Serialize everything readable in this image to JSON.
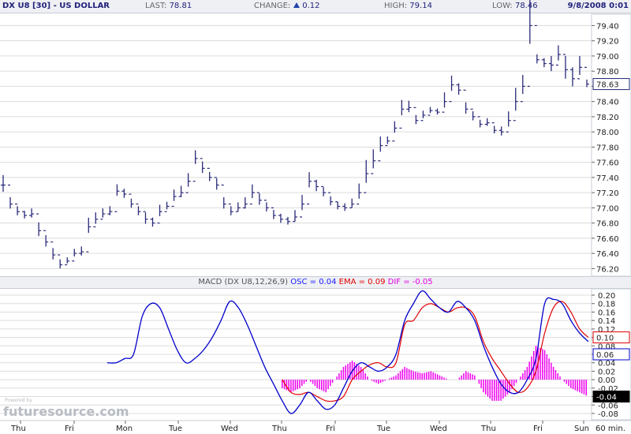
{
  "header": {
    "title": "DX U8 [30] - US DOLLAR",
    "last_label": "LAST:",
    "last_value": "78.81",
    "change_label": "CHANGE:",
    "change_value": "0.12",
    "high_label": "HIGH:",
    "high_value": "79.14",
    "low_label": "LOW:",
    "low_value": "78.46",
    "datetime": "9/8/2008 0:01"
  },
  "macd_legend": {
    "prefix": "MACD (DX U8,12,26,9)",
    "osc": "OSC = 0.04",
    "ema": "EMA = 0.09",
    "dif": "DIF = -0.05"
  },
  "watermark": {
    "small": "Powered by",
    "text": "futuresource.com"
  },
  "colors": {
    "price": "#2a2a7a",
    "macd": "#0000cc",
    "signal": "#e00000",
    "histogram": "#ee00ee",
    "grid": "#dcdcdc",
    "last_tag_border": "#2a2a7a"
  },
  "chart_data": [
    {
      "type": "bar",
      "subtype": "ohlc",
      "title": "DX U8 [30] - US DOLLAR",
      "ylim": [
        76.1,
        79.55
      ],
      "y_ticks": [
        "79.40",
        "79.20",
        "79.00",
        "78.80",
        "78.60",
        "78.40",
        "78.20",
        "78.00",
        "77.80",
        "77.60",
        "77.40",
        "77.20",
        "77.00",
        "76.80",
        "76.60",
        "76.40",
        "76.20"
      ],
      "last_tag": "78.63",
      "x_labels": [
        "Thu",
        "Fri",
        "Mon",
        "Tue",
        "Wed",
        "Thu",
        "Fri",
        "Tue",
        "Wed",
        "Thu",
        "Fri",
        "Sun"
      ],
      "x_suffix": "60 min.",
      "closes": [
        77.3,
        77.05,
        76.95,
        76.9,
        76.92,
        76.7,
        76.55,
        76.38,
        76.25,
        76.3,
        76.4,
        76.42,
        76.75,
        76.85,
        76.92,
        76.95,
        77.22,
        77.18,
        77.05,
        76.95,
        76.85,
        76.8,
        76.95,
        77.02,
        77.15,
        77.2,
        77.35,
        77.65,
        77.52,
        77.4,
        77.3,
        77.05,
        76.95,
        77.0,
        77.05,
        77.2,
        77.1,
        77.0,
        76.9,
        76.85,
        76.82,
        76.88,
        77.05,
        77.35,
        77.28,
        77.2,
        77.08,
        77.02,
        77.0,
        77.05,
        77.2,
        77.45,
        77.62,
        77.82,
        77.88,
        78.05,
        78.3,
        78.32,
        78.15,
        78.22,
        78.28,
        78.26,
        78.4,
        78.62,
        78.55,
        78.3,
        78.2,
        78.1,
        78.12,
        78.02,
        78.0,
        78.15,
        78.4,
        78.6,
        79.4,
        78.95,
        78.9,
        78.88,
        79.02,
        78.82,
        78.7,
        78.85,
        78.63
      ],
      "ranges": [
        0.22,
        0.15,
        0.12,
        0.1,
        0.12,
        0.18,
        0.15,
        0.15,
        0.12,
        0.08,
        0.1,
        0.12,
        0.2,
        0.15,
        0.12,
        0.12,
        0.15,
        0.12,
        0.12,
        0.12,
        0.15,
        0.12,
        0.15,
        0.1,
        0.15,
        0.15,
        0.18,
        0.18,
        0.15,
        0.12,
        0.15,
        0.15,
        0.12,
        0.12,
        0.15,
        0.18,
        0.15,
        0.12,
        0.12,
        0.12,
        0.1,
        0.15,
        0.2,
        0.2,
        0.15,
        0.12,
        0.12,
        0.1,
        0.1,
        0.12,
        0.2,
        0.3,
        0.25,
        0.2,
        0.1,
        0.15,
        0.2,
        0.15,
        0.12,
        0.1,
        0.08,
        0.08,
        0.2,
        0.2,
        0.15,
        0.15,
        0.12,
        0.1,
        0.1,
        0.1,
        0.12,
        0.2,
        0.3,
        0.25,
        0.6,
        0.12,
        0.12,
        0.2,
        0.2,
        0.3,
        0.25,
        0.25,
        0.1
      ]
    },
    {
      "type": "line",
      "title": "MACD (DX U8,12,26,9)",
      "ylim": [
        -0.095,
        0.215
      ],
      "y_ticks": [
        "0.20",
        "0.18",
        "0.16",
        "0.14",
        "0.12",
        "0.10",
        "0.08",
        "0.06",
        "0.04",
        "0.02",
        "0.00",
        "-0.02",
        "-0.04",
        "-0.06",
        "-0.08"
      ],
      "tags": {
        "ema": "0.10",
        "osc": "0.06",
        "dif": "-0.04"
      },
      "series": [
        {
          "name": "OSC",
          "values": [
            0.04,
            0.04,
            0.05,
            0.06,
            0.15,
            0.18,
            0.17,
            0.12,
            0.07,
            0.04,
            0.05,
            0.07,
            0.1,
            0.14,
            0.185,
            0.17,
            0.13,
            0.08,
            0.03,
            -0.01,
            -0.05,
            -0.08,
            -0.06,
            -0.03,
            -0.05,
            -0.07,
            -0.06,
            -0.02,
            0.02,
            0.04,
            0.03,
            0.02,
            0.03,
            0.06,
            0.14,
            0.18,
            0.21,
            0.19,
            0.17,
            0.16,
            0.185,
            0.17,
            0.14,
            0.08,
            0.03,
            -0.01,
            -0.03,
            -0.03,
            0.0,
            0.05,
            0.18,
            0.19,
            0.18,
            0.14,
            0.11,
            0.09
          ]
        },
        {
          "name": "EMA",
          "values": [
            null,
            null,
            null,
            null,
            null,
            null,
            null,
            null,
            null,
            null,
            null,
            null,
            null,
            null,
            null,
            null,
            null,
            null,
            null,
            null,
            0.0,
            -0.03,
            -0.035,
            -0.03,
            -0.04,
            -0.05,
            -0.05,
            -0.04,
            0.0,
            0.02,
            0.035,
            0.04,
            0.03,
            0.04,
            0.13,
            0.14,
            0.17,
            0.18,
            0.17,
            0.16,
            0.17,
            0.17,
            0.15,
            0.09,
            0.05,
            0.02,
            -0.01,
            -0.03,
            -0.02,
            0.02,
            0.11,
            0.17,
            0.185,
            0.16,
            0.12,
            0.1
          ]
        },
        {
          "name": "DIF",
          "values": [
            null,
            null,
            null,
            null,
            null,
            null,
            null,
            null,
            null,
            null,
            null,
            null,
            null,
            null,
            null,
            null,
            null,
            null,
            null,
            null,
            -0.02,
            -0.03,
            -0.02,
            0.0,
            -0.02,
            -0.03,
            0.0,
            0.03,
            0.045,
            0.03,
            0.0,
            -0.01,
            0.0,
            0.01,
            0.03,
            0.02,
            0.015,
            0.02,
            0.01,
            0.0,
            0.0,
            0.02,
            0.01,
            -0.03,
            -0.05,
            -0.05,
            -0.03,
            0.0,
            0.03,
            0.08,
            0.07,
            0.03,
            0.0,
            -0.02,
            -0.03,
            -0.04
          ]
        }
      ]
    }
  ]
}
